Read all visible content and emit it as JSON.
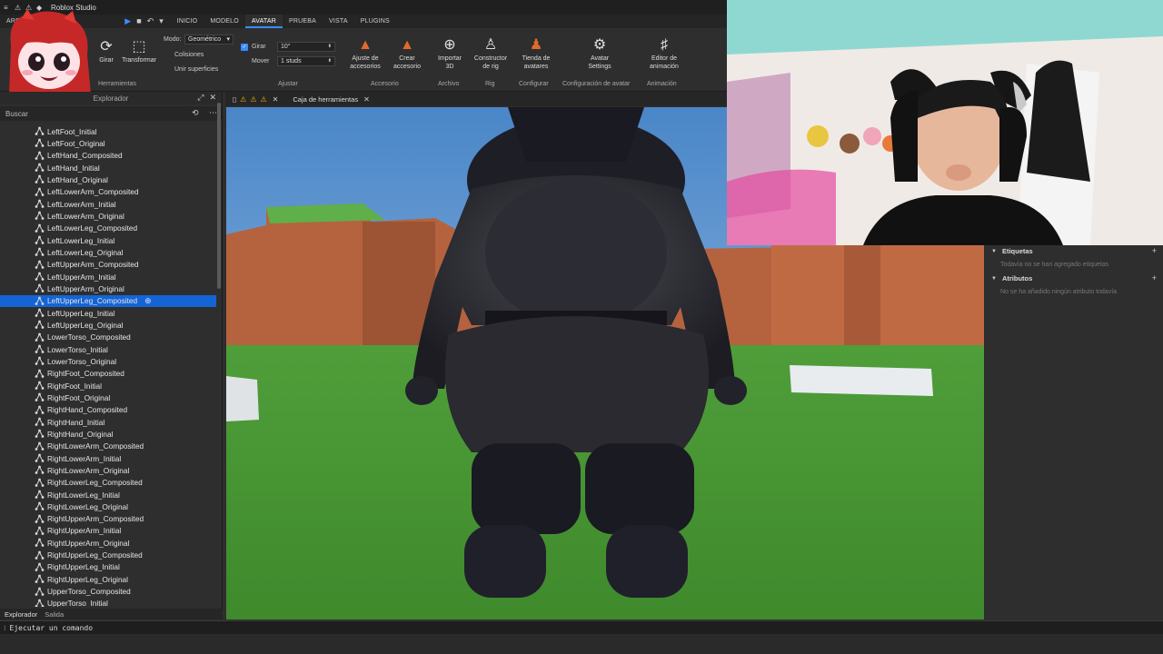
{
  "window": {
    "title": "Roblox Studio"
  },
  "menu": {
    "tabs": [
      {
        "label": "ARCHIVO",
        "active": false
      },
      {
        "label": "INICIO",
        "active": false
      },
      {
        "label": "MODELO",
        "active": false
      },
      {
        "label": "AVATAR",
        "active": true
      },
      {
        "label": "PRUEBA",
        "active": false
      },
      {
        "label": "VISTA",
        "active": false
      },
      {
        "label": "PLUGINS",
        "active": false
      }
    ]
  },
  "ribbon": {
    "girar": "Girar",
    "transformar": "Transformar",
    "herramientas": "Herramientas",
    "modo_label": "Modo:",
    "modo_value": "Geométrico",
    "colisiones": "Colisiones",
    "unir_superficies": "Unir superficies",
    "girar_check": "Girar",
    "girar_value": "10°",
    "mover": "Mover",
    "mover_value": "1 studs",
    "ajustar": "Ajustar",
    "ajuste_accesorios_1": "Ajuste de",
    "ajuste_accesorios_2": "accesorios",
    "crear_accesorio_1": "Crear",
    "crear_accesorio_2": "accesorio",
    "accesorio_group": "Accesorio",
    "importar_1": "Importar",
    "importar_2": "3D",
    "archivo_group": "Archivo",
    "constructor_1": "Constructor",
    "constructor_2": "de rig",
    "rig_group": "Rig",
    "tienda_1": "Tienda de",
    "tienda_2": "avatares",
    "configurar_group": "Configurar",
    "avatar_settings_1": "Avatar",
    "avatar_settings_2": "Settings",
    "config_avatar_group": "Configuración de avatar",
    "editor_anim_1": "Editor de",
    "editor_anim_2": "animación",
    "animacion_group": "Animación"
  },
  "explorer": {
    "title": "Explorador",
    "search_placeholder": "Buscar",
    "selected_index": 14,
    "items": [
      "LeftFoot_Initial",
      "LeftFoot_Original",
      "LeftHand_Composited",
      "LeftHand_Initial",
      "LeftHand_Original",
      "LeftLowerArm_Composited",
      "LeftLowerArm_Initial",
      "LeftLowerArm_Original",
      "LeftLowerLeg_Composited",
      "LeftLowerLeg_Initial",
      "LeftLowerLeg_Original",
      "LeftUpperArm_Composited",
      "LeftUpperArm_Initial",
      "LeftUpperArm_Original",
      "LeftUpperLeg_Composited",
      "LeftUpperLeg_Initial",
      "LeftUpperLeg_Original",
      "LowerTorso_Composited",
      "LowerTorso_Initial",
      "LowerTorso_Original",
      "RightFoot_Composited",
      "RightFoot_Initial",
      "RightFoot_Original",
      "RightHand_Composited",
      "RightHand_Initial",
      "RightHand_Original",
      "RightLowerArm_Composited",
      "RightLowerArm_Initial",
      "RightLowerArm_Original",
      "RightLowerLeg_Composited",
      "RightLowerLeg_Initial",
      "RightLowerLeg_Original",
      "RightUpperArm_Composited",
      "RightUpperArm_Initial",
      "RightUpperArm_Original",
      "RightUpperLeg_Composited",
      "RightUpperLeg_Initial",
      "RightUpperLeg_Original",
      "UpperTorso_Composited",
      "UpperTorso_Initial"
    ]
  },
  "bottom_tabs": {
    "explorer": "Explorador",
    "output": "Salida"
  },
  "command_bar": {
    "placeholder": "Ejecutar un comando"
  },
  "doc_tabs": {
    "toolbox": "Caja de herramientas"
  },
  "properties": {
    "tags_title": "Etiquetas",
    "tags_empty": "Todavía no se han agregado etiquetas",
    "attributes_title": "Atributos",
    "attributes_empty": "No se ha añadido ningún atributo todavía"
  },
  "colors": {
    "accent": "#3a8dff",
    "selection": "#1464d6",
    "panel": "#2e2e2e",
    "warning": "#f2b705"
  }
}
